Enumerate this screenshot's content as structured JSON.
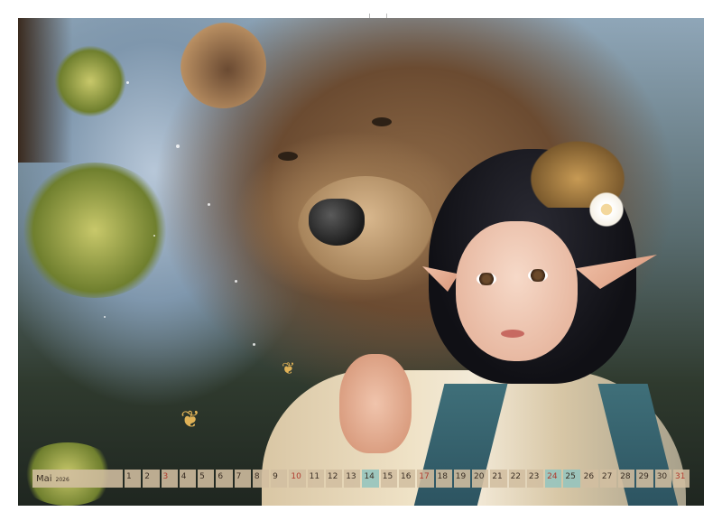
{
  "calendar": {
    "month": "Mai",
    "year": "2026",
    "days": [
      {
        "n": "1",
        "sunday": false,
        "holiday": false
      },
      {
        "n": "2",
        "sunday": false,
        "holiday": false
      },
      {
        "n": "3",
        "sunday": true,
        "holiday": false
      },
      {
        "n": "4",
        "sunday": false,
        "holiday": false
      },
      {
        "n": "5",
        "sunday": false,
        "holiday": false
      },
      {
        "n": "6",
        "sunday": false,
        "holiday": false
      },
      {
        "n": "7",
        "sunday": false,
        "holiday": false
      },
      {
        "n": "8",
        "sunday": false,
        "holiday": false
      },
      {
        "n": "9",
        "sunday": false,
        "holiday": false
      },
      {
        "n": "10",
        "sunday": true,
        "holiday": false
      },
      {
        "n": "11",
        "sunday": false,
        "holiday": false
      },
      {
        "n": "12",
        "sunday": false,
        "holiday": false
      },
      {
        "n": "13",
        "sunday": false,
        "holiday": false
      },
      {
        "n": "14",
        "sunday": false,
        "holiday": true
      },
      {
        "n": "15",
        "sunday": false,
        "holiday": false
      },
      {
        "n": "16",
        "sunday": false,
        "holiday": false
      },
      {
        "n": "17",
        "sunday": true,
        "holiday": false
      },
      {
        "n": "18",
        "sunday": false,
        "holiday": false
      },
      {
        "n": "19",
        "sunday": false,
        "holiday": false
      },
      {
        "n": "20",
        "sunday": false,
        "holiday": false
      },
      {
        "n": "21",
        "sunday": false,
        "holiday": false
      },
      {
        "n": "22",
        "sunday": false,
        "holiday": false
      },
      {
        "n": "23",
        "sunday": false,
        "holiday": false
      },
      {
        "n": "24",
        "sunday": true,
        "holiday": true
      },
      {
        "n": "25",
        "sunday": false,
        "holiday": true
      },
      {
        "n": "26",
        "sunday": false,
        "holiday": false
      },
      {
        "n": "27",
        "sunday": false,
        "holiday": false
      },
      {
        "n": "28",
        "sunday": false,
        "holiday": false
      },
      {
        "n": "29",
        "sunday": false,
        "holiday": false
      },
      {
        "n": "30",
        "sunday": false,
        "holiday": false
      },
      {
        "n": "31",
        "sunday": true,
        "holiday": false
      }
    ]
  },
  "colors": {
    "calendar_cell": "#d2bea0",
    "holiday_cell": "#96c4be",
    "sunday_text": "#b03a2e",
    "text": "#3a2e24"
  }
}
